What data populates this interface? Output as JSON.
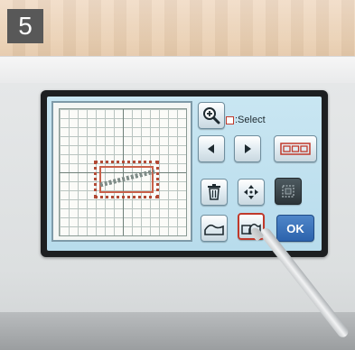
{
  "step": {
    "number": "5"
  },
  "screen": {
    "select_label": ":Select",
    "buttons": {
      "zoom": "zoom-in",
      "left": "arrow-left",
      "right": "arrow-right",
      "frame_pattern": "frame-pattern",
      "delete": "trash",
      "move": "move-arrows",
      "frame_select": "frame-select",
      "outline": "outline-shape",
      "outline_alt": "outline-shape-with-frame",
      "ok": "OK"
    }
  },
  "colors": {
    "screen_bg": "#c9e6f2",
    "ok_button": "#2c63ad",
    "pattern_frame": "#b24a35"
  }
}
